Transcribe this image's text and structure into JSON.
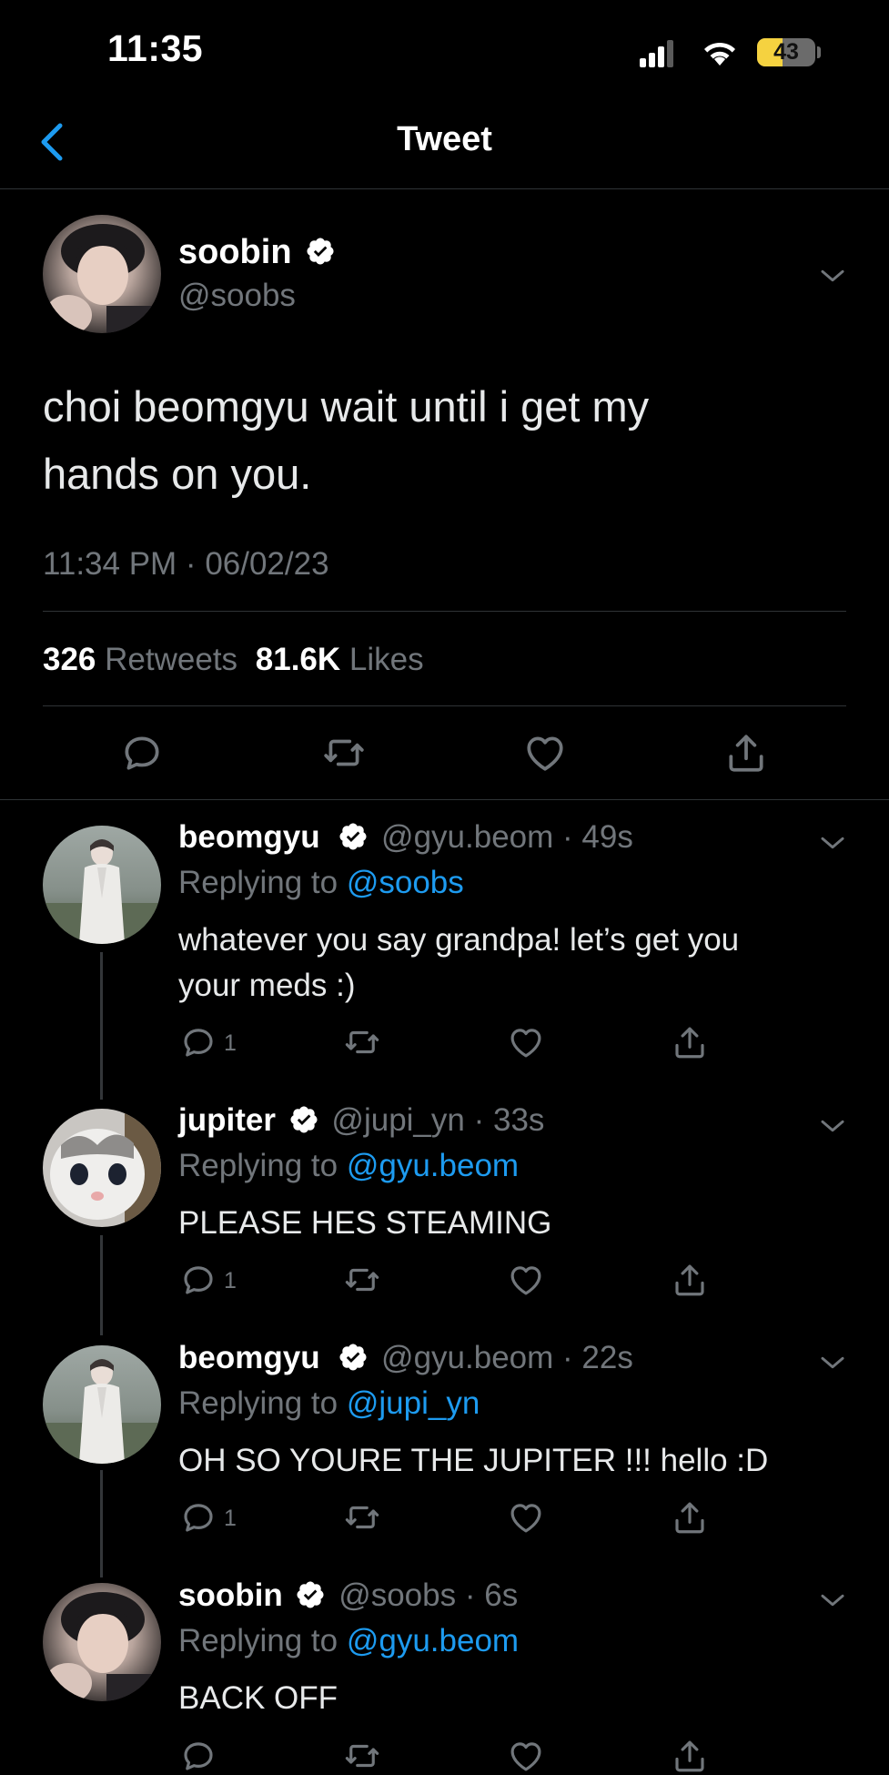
{
  "status_bar": {
    "time": "11:35",
    "battery": "43",
    "battery_level": 0.43
  },
  "nav": {
    "title": "Tweet"
  },
  "main_tweet": {
    "name": "soobin",
    "handle": "@soobs",
    "text_line1": "choi beomgyu wait until i get my",
    "text_line2": "hands on you.",
    "timestamp": "11:34 PM · 06/02/23",
    "retweets_count": "326",
    "retweets_label": "Retweets",
    "likes_count": "81.6K",
    "likes_label": "Likes"
  },
  "replies": [
    {
      "name": "beomgyu",
      "handle": "@gyu.beom",
      "time": "· 49s",
      "replying_label": "Replying to",
      "replying_to": "@soobs",
      "text_line1": "whatever you say grandpa! let’s get you",
      "text_line2": "your meds :)",
      "reply_count": "1"
    },
    {
      "name": "jupiter",
      "handle": "@jupi_yn",
      "time": "· 33s",
      "replying_label": "Replying to",
      "replying_to": "@gyu.beom",
      "text_line1": "PLEASE HES STEAMING",
      "reply_count": "1"
    },
    {
      "name": "beomgyu",
      "handle": "@gyu.beom",
      "time": "· 22s",
      "replying_label": "Replying to",
      "replying_to": "@jupi_yn",
      "text_line1": "OH SO YOURE THE JUPITER !!! hello :D",
      "reply_count": "1"
    },
    {
      "name": "soobin",
      "handle": "@soobs",
      "time": "· 6s",
      "replying_label": "Replying to",
      "replying_to": "@gyu.beom",
      "text_line1": "BACK OFF"
    }
  ],
  "colors": {
    "accent": "#1d9bf0",
    "muted": "#71767b",
    "battery": "#f5d240"
  }
}
